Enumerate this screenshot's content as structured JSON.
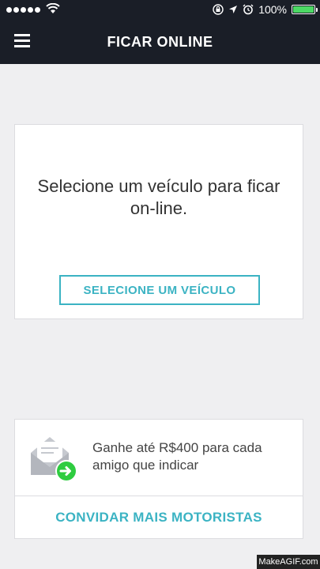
{
  "status_bar": {
    "battery_percent": "100%"
  },
  "header": {
    "title": "FICAR ONLINE"
  },
  "select_card": {
    "message": "Selecione um veículo para ficar on-line.",
    "button_label": "SELECIONE UM VEÍCULO"
  },
  "invite_card": {
    "text": "Ganhe até R$400 para cada amigo que indicar",
    "button_label": "CONVIDAR MAIS MOTORISTAS"
  },
  "watermark": "MakeAGIF.com",
  "colors": {
    "accent": "#3bb3c3",
    "header_bg": "#1a1e27",
    "badge_green": "#2ecc40",
    "battery": "#4cd964"
  }
}
